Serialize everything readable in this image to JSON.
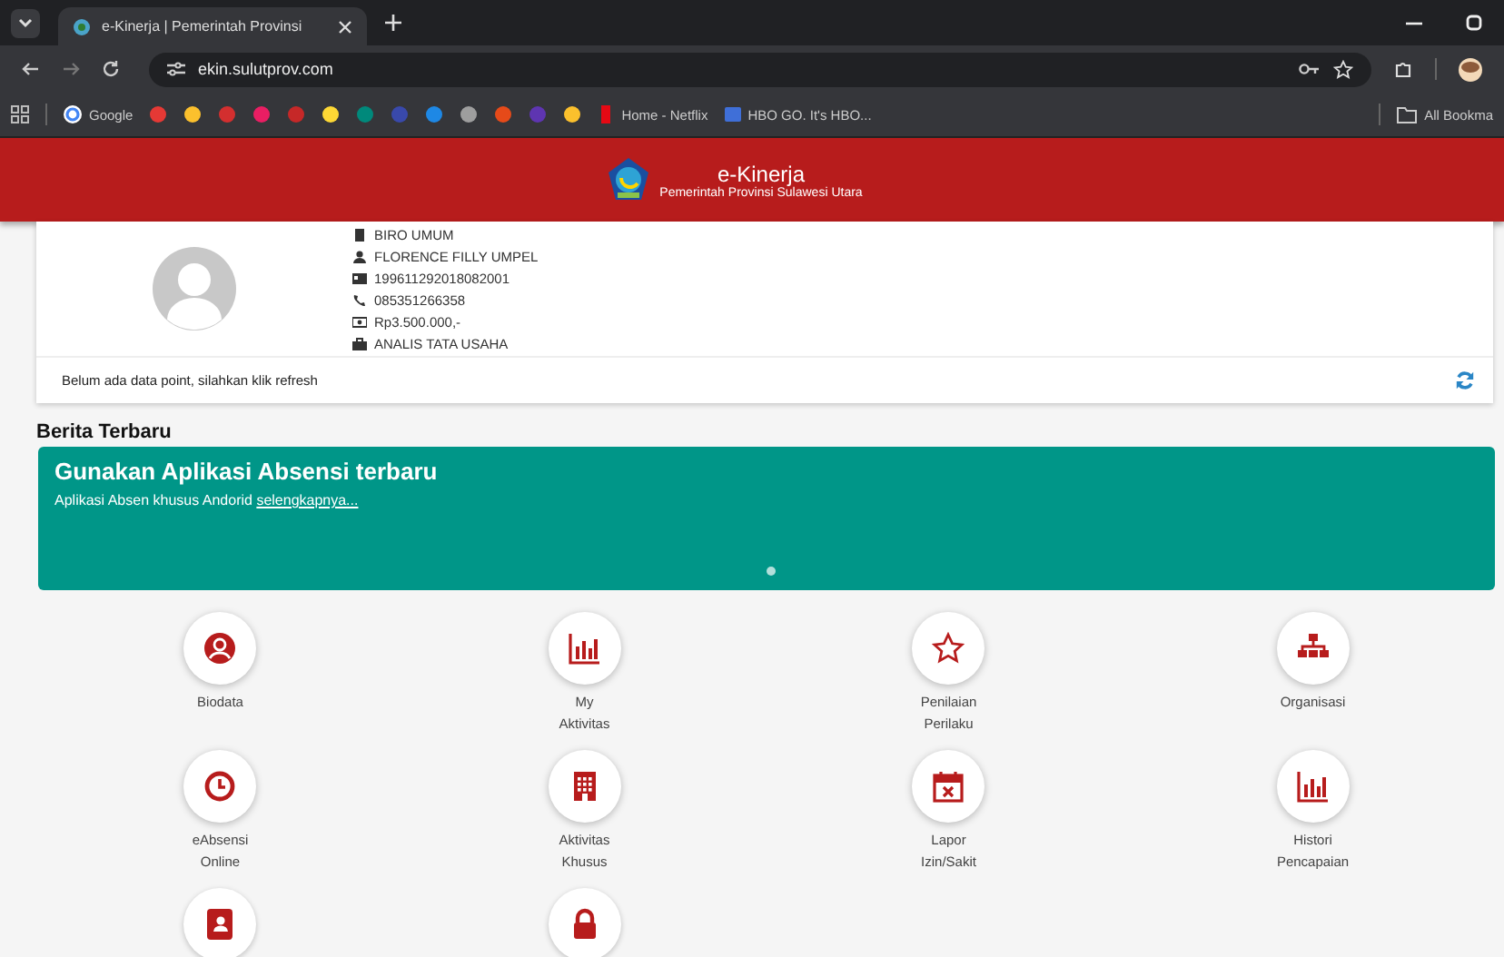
{
  "browser": {
    "tab_title": "e-Kinerja | Pemerintah Provinsi",
    "url": "ekin.sulutprov.com",
    "bookmarks": [
      {
        "label": "Google"
      },
      {
        "label": "Home - Netflix"
      },
      {
        "label": "HBO GO. It's HBO..."
      }
    ],
    "all_bookmarks": "All Bookma"
  },
  "header": {
    "title": "e-Kinerja",
    "subtitle": "Pemerintah Provinsi Sulawesi Utara"
  },
  "profile": {
    "lines": [
      "BIRO UMUM",
      "FLORENCE FILLY UMPEL",
      "199611292018082001",
      "085351266358",
      "Rp3.500.000,-",
      "ANALIS TATA USAHA"
    ],
    "notice": "Belum ada data point, silahkan klik refresh"
  },
  "news": {
    "heading": "Berita Terbaru",
    "title": "Gunakan Aplikasi Absensi terbaru",
    "text": "Aplikasi Absen khusus Andorid",
    "link": "selengkapnya..."
  },
  "menu": [
    {
      "lines": [
        "Biodata"
      ]
    },
    {
      "lines": [
        "My",
        "Aktivitas"
      ]
    },
    {
      "lines": [
        "Penilaian",
        "Perilaku"
      ]
    },
    {
      "lines": [
        "Organisasi"
      ]
    },
    {
      "lines": [
        "eAbsensi",
        "Online"
      ]
    },
    {
      "lines": [
        "Aktivitas",
        "Khusus"
      ]
    },
    {
      "lines": [
        "Lapor",
        "Izin/Sakit"
      ]
    },
    {
      "lines": [
        "Histori",
        "Pencapaian"
      ]
    },
    {
      "kind": "icon_only"
    },
    {
      "kind": "icon_only"
    }
  ]
}
